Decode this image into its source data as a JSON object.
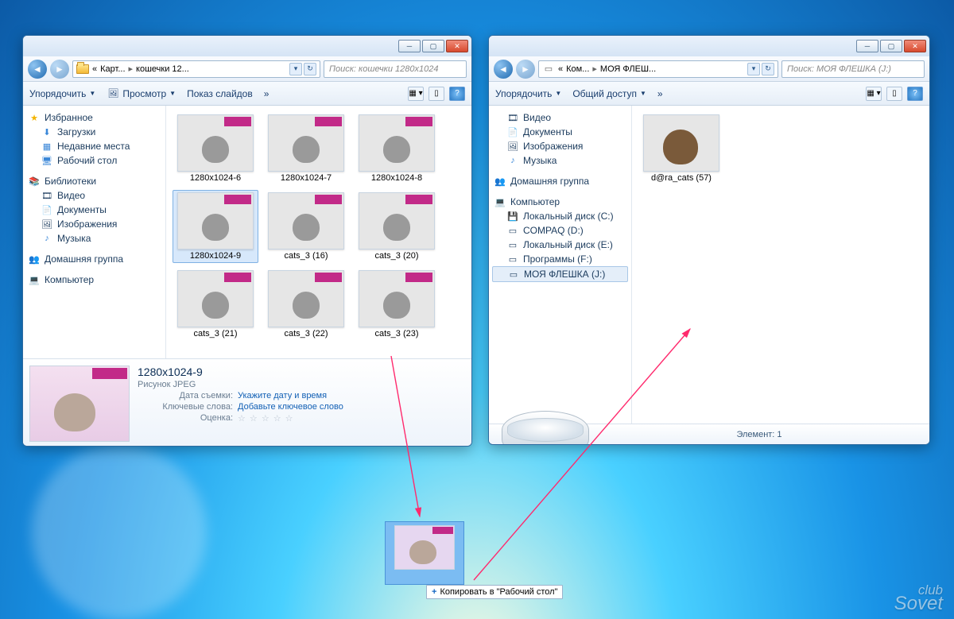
{
  "window1": {
    "breadcrumb": [
      "«",
      "Карт...",
      "кошечки 12..."
    ],
    "search_placeholder": "Поиск: кошечки 1280x1024",
    "toolbar": {
      "organize": "Упорядочить",
      "preview": "Просмотр",
      "slideshow": "Показ слайдов",
      "more": "»"
    },
    "favorites": {
      "title": "Избранное",
      "items": [
        "Загрузки",
        "Недавние места",
        "Рабочий стол"
      ]
    },
    "libraries": {
      "title": "Библиотеки",
      "items": [
        "Видео",
        "Документы",
        "Изображения",
        "Музыка"
      ]
    },
    "homegroup": "Домашняя группа",
    "computer": "Компьютер",
    "thumbs": [
      {
        "name": "1280x1024-6",
        "art": "art-pink"
      },
      {
        "name": "1280x1024-7",
        "art": "art-grey"
      },
      {
        "name": "1280x1024-8",
        "art": "art-pink"
      },
      {
        "name": "1280x1024-9",
        "art": "art-pink",
        "selected": true
      },
      {
        "name": "cats_3 (16)",
        "art": "art-dark"
      },
      {
        "name": "cats_3 (20)",
        "art": "art-grey"
      },
      {
        "name": "cats_3 (21)",
        "art": "art-heart"
      },
      {
        "name": "cats_3 (22)",
        "art": "art-blue"
      },
      {
        "name": "cats_3 (23)",
        "art": "art-grey"
      }
    ],
    "details": {
      "name": "1280x1024-9",
      "type": "Рисунок JPEG",
      "date_label": "Дата съемки:",
      "date_value": "Укажите дату и время",
      "tags_label": "Ключевые слова:",
      "tags_value": "Добавьте ключевое слово",
      "rating_label": "Оценка:"
    }
  },
  "window2": {
    "breadcrumb": [
      "«",
      "Ком...",
      "МОЯ ФЛЕШ..."
    ],
    "search_placeholder": "Поиск: МОЯ ФЛЕШКА (J:)",
    "toolbar": {
      "organize": "Упорядочить",
      "share": "Общий доступ",
      "more": "»"
    },
    "libraries": {
      "items": [
        "Видео",
        "Документы",
        "Изображения",
        "Музыка"
      ]
    },
    "homegroup": "Домашняя группа",
    "computer": {
      "title": "Компьютер",
      "drives": [
        "Локальный диск (C:)",
        "COMPAQ (D:)",
        "Локальный диск (E:)",
        "Программы  (F:)",
        "МОЯ ФЛЕШКА (J:)"
      ]
    },
    "thumb": {
      "name": "d@ra_cats (57)"
    },
    "status_label": "Элемент: 1"
  },
  "drag": {
    "tooltip": "Копировать в \"Рабочий стол\""
  },
  "watermark": {
    "l1": "club",
    "l2": "Sovet"
  }
}
